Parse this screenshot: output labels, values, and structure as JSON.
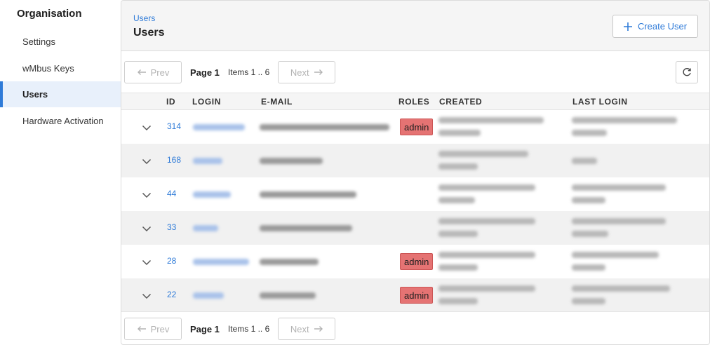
{
  "sidebar": {
    "title": "Organisation",
    "items": [
      {
        "label": "Settings"
      },
      {
        "label": "wMbus Keys"
      },
      {
        "label": "Users"
      },
      {
        "label": "Hardware Activation"
      }
    ]
  },
  "header": {
    "breadcrumb": "Users",
    "title": "Users",
    "create_label": "Create User"
  },
  "pager": {
    "prev_label": "Prev",
    "next_label": "Next",
    "page_label": "Page 1",
    "items_label": "Items 1 .. 6"
  },
  "table": {
    "columns": [
      "ID",
      "LOGIN",
      "E-MAIL",
      "ROLES",
      "CREATED",
      "LAST LOGIN"
    ],
    "rows": [
      {
        "id": "314",
        "role": "admin"
      },
      {
        "id": "168",
        "role": ""
      },
      {
        "id": "44",
        "role": ""
      },
      {
        "id": "33",
        "role": ""
      },
      {
        "id": "28",
        "role": "admin"
      },
      {
        "id": "22",
        "role": "admin"
      }
    ]
  },
  "colors": {
    "accent": "#2f7bd8",
    "admin_badge": "#e57373",
    "active_nav_bg": "#e8f0fb"
  },
  "icons": [
    "plus-icon",
    "arrow-left-icon",
    "arrow-right-icon",
    "refresh-icon",
    "chevron-down-icon"
  ]
}
